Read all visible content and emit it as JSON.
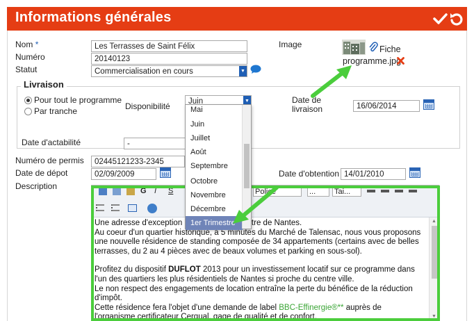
{
  "header": {
    "title": "Informations générales",
    "color": "#e53d14"
  },
  "form": {
    "nom": {
      "label": "Nom",
      "required_mark": "*",
      "value": "Les Terrasses de Saint Félix"
    },
    "numero": {
      "label": "Numéro",
      "value": "20140123"
    },
    "statut": {
      "label": "Statut",
      "value": "Commercialisation en cours"
    },
    "image": {
      "label": "Image",
      "link_text": "Fiche",
      "file_name": "programme.jpg"
    },
    "livraison": {
      "legend": "Livraison",
      "radio_all": "Pour tout le programme",
      "radio_tranche": "Par tranche",
      "dispo_label": "Disponibilité",
      "dispo_value": "Juin",
      "date_livraison_label_1": "Date de",
      "date_livraison_label_2": "livraison",
      "date_livraison_value": "16/06/2014",
      "actabilite_label": "Date d'actabilité",
      "actabilite_value": "-"
    },
    "permis": {
      "label": "Numéro de permis",
      "value": "02445121233-2345"
    },
    "depot": {
      "label": "Date de dépot",
      "value": "02/09/2009"
    },
    "obtention": {
      "label": "Date d'obtention",
      "value": "14/01/2010"
    },
    "description": {
      "label": "Description"
    }
  },
  "dropdown": {
    "items": [
      "Mai",
      "Juin",
      "Juillet",
      "Août",
      "Septembre",
      "Octobre",
      "Novembre",
      "Décembre",
      "1er Trimestre"
    ],
    "selected": "1er Trimestre"
  },
  "toolbar": {
    "bold": "G",
    "italic": "I",
    "underline": "S",
    "font_select": "Police",
    "size_select": "...",
    "size_select_2": "Tai..."
  },
  "editor": {
    "p1_line1": "Une adresse d'exception ... estir dans le centre de Nantes.",
    "p1_line2": "Au coeur d'un quartier historique, à 5 minutes du Marché de Talensac, nous vous proposons",
    "p1_line3": "une nouvelle résidence de standing composée de 34 appartements (certains avec de belles",
    "p1_line4": "terrasses, du 2 au 4 pièces avec de beaux volumes et parking en sous-sol).",
    "p2_pre": "Profitez du dispositif ",
    "p2_bold": "DUFLOT",
    "p2_post": " 2013 pour un investissement locatif sur ce programme dans",
    "p2_line2": "l'un des quartiers les plus résidentiels de Nantes si proche du centre ville.",
    "p2_line3": "Le non respect des engagements de location entraîne la perte du bénéfice de la réduction",
    "p2_line4": "d'impôt.",
    "p3_pre": "Cette résidence fera l'objet d'une demande de label ",
    "p3_green": "BBC-Effinergie®**",
    "p3_post": " auprès de",
    "p3_line2": "l'organisme certificateur Cerqual, gage de qualité et de confort."
  },
  "colors": {
    "accent": "#e53d14",
    "highlight": "#4bcd3c",
    "select_button": "#1f5fb5",
    "bbc_text": "#3aa535"
  }
}
